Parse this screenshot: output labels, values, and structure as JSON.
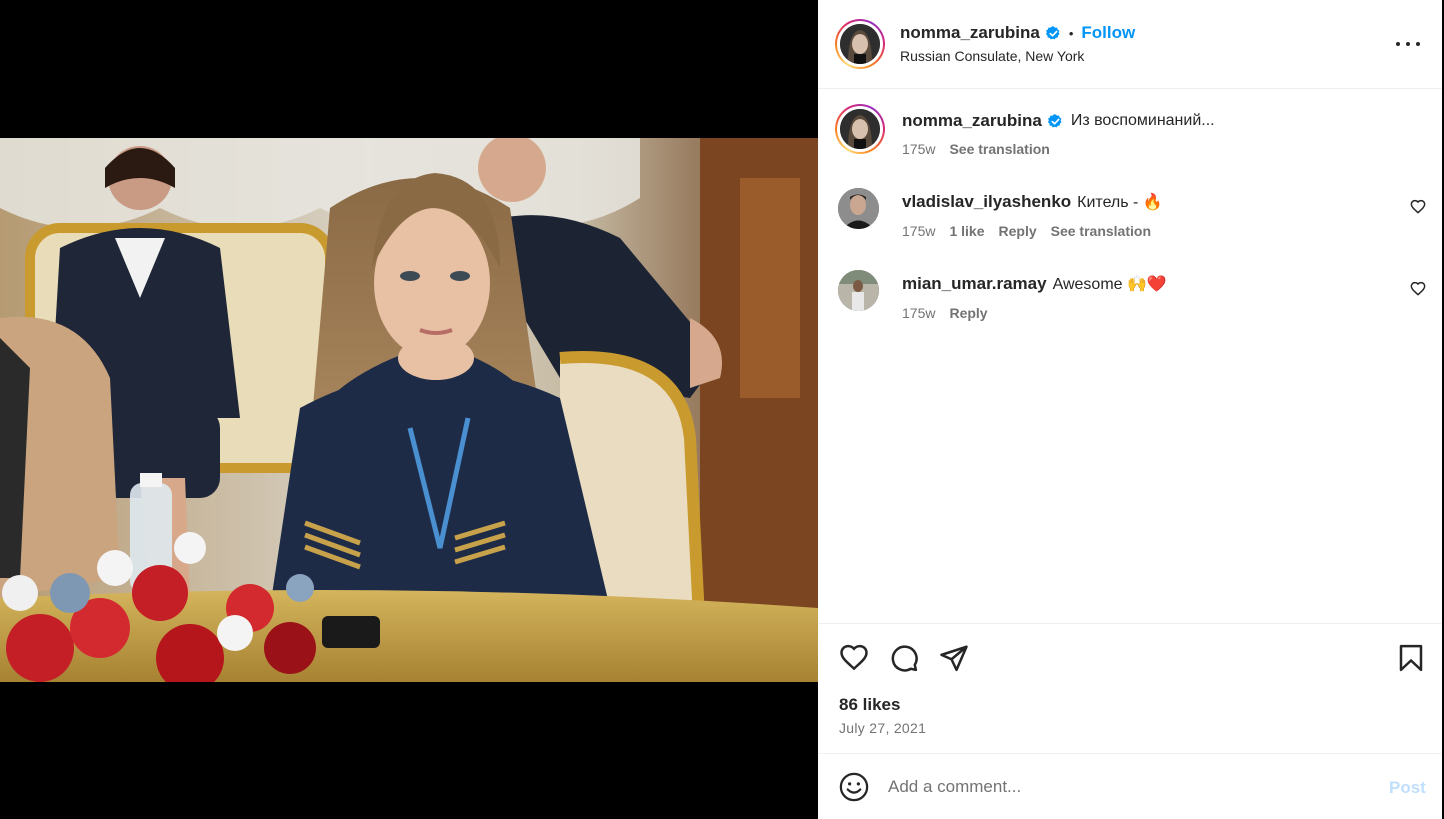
{
  "post": {
    "author": "nomma_zarubina",
    "follow_label": "Follow",
    "dot": "•",
    "location": "Russian Consulate, New York",
    "more_label": "More options"
  },
  "caption": {
    "author": "nomma_zarubina",
    "text": "Из воспоминаний...",
    "time": "175w",
    "see_translation": "See translation"
  },
  "comments": [
    {
      "author": "vladislav_ilyashenko",
      "text": "Китель - 🔥",
      "time": "175w",
      "likes": "1 like",
      "reply": "Reply",
      "see_translation": "See translation"
    },
    {
      "author": "mian_umar.ramay",
      "text": "Awesome 🙌❤️",
      "time": "175w",
      "reply": "Reply"
    }
  ],
  "stats": {
    "likes": "86 likes",
    "date": "July 27, 2021"
  },
  "composer": {
    "placeholder": "Add a comment...",
    "post_label": "Post"
  },
  "colors": {
    "accent": "#0095f6",
    "post_disabled": "#c0dffd",
    "verified": "#0095f6"
  }
}
